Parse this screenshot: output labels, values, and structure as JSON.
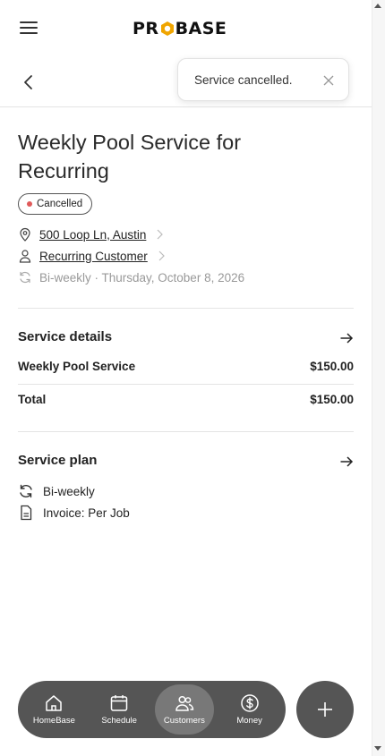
{
  "header": {
    "logo_text_left": "PR",
    "logo_text_right": "BASE",
    "logo_accent": "#f0a500"
  },
  "toast": {
    "message": "Service cancelled."
  },
  "job": {
    "title": "Weekly Pool Service for Recurring",
    "status": "Cancelled",
    "status_color": "#e05a5a",
    "address": "500 Loop Ln, Austin",
    "customer": "Recurring Customer",
    "schedule": "Bi-weekly · Thursday, October 8, 2026"
  },
  "service_details": {
    "heading": "Service details",
    "items": [
      {
        "name": "Weekly Pool Service",
        "amount": "$150.00"
      }
    ],
    "total_label": "Total",
    "total_amount": "$150.00"
  },
  "service_plan": {
    "heading": "Service plan",
    "frequency": "Bi-weekly",
    "invoice": "Invoice: Per Job"
  },
  "bottom_nav": {
    "items": [
      {
        "label": "HomeBase",
        "icon": "home-icon"
      },
      {
        "label": "Schedule",
        "icon": "calendar-icon"
      },
      {
        "label": "Customers",
        "icon": "users-icon",
        "active": true
      },
      {
        "label": "Money",
        "icon": "dollar-icon"
      }
    ],
    "fab_icon": "plus-icon",
    "bar_color": "#555555"
  }
}
